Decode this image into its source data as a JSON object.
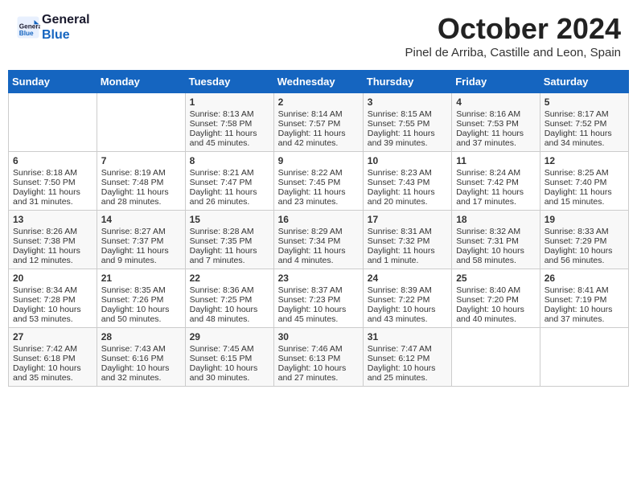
{
  "header": {
    "logo_line1": "General",
    "logo_line2": "Blue",
    "month_title": "October 2024",
    "location": "Pinel de Arriba, Castille and Leon, Spain"
  },
  "days_of_week": [
    "Sunday",
    "Monday",
    "Tuesday",
    "Wednesday",
    "Thursday",
    "Friday",
    "Saturday"
  ],
  "weeks": [
    [
      {
        "day": "",
        "content": ""
      },
      {
        "day": "",
        "content": ""
      },
      {
        "day": "1",
        "content": "Sunrise: 8:13 AM\nSunset: 7:58 PM\nDaylight: 11 hours and 45 minutes."
      },
      {
        "day": "2",
        "content": "Sunrise: 8:14 AM\nSunset: 7:57 PM\nDaylight: 11 hours and 42 minutes."
      },
      {
        "day": "3",
        "content": "Sunrise: 8:15 AM\nSunset: 7:55 PM\nDaylight: 11 hours and 39 minutes."
      },
      {
        "day": "4",
        "content": "Sunrise: 8:16 AM\nSunset: 7:53 PM\nDaylight: 11 hours and 37 minutes."
      },
      {
        "day": "5",
        "content": "Sunrise: 8:17 AM\nSunset: 7:52 PM\nDaylight: 11 hours and 34 minutes."
      }
    ],
    [
      {
        "day": "6",
        "content": "Sunrise: 8:18 AM\nSunset: 7:50 PM\nDaylight: 11 hours and 31 minutes."
      },
      {
        "day": "7",
        "content": "Sunrise: 8:19 AM\nSunset: 7:48 PM\nDaylight: 11 hours and 28 minutes."
      },
      {
        "day": "8",
        "content": "Sunrise: 8:21 AM\nSunset: 7:47 PM\nDaylight: 11 hours and 26 minutes."
      },
      {
        "day": "9",
        "content": "Sunrise: 8:22 AM\nSunset: 7:45 PM\nDaylight: 11 hours and 23 minutes."
      },
      {
        "day": "10",
        "content": "Sunrise: 8:23 AM\nSunset: 7:43 PM\nDaylight: 11 hours and 20 minutes."
      },
      {
        "day": "11",
        "content": "Sunrise: 8:24 AM\nSunset: 7:42 PM\nDaylight: 11 hours and 17 minutes."
      },
      {
        "day": "12",
        "content": "Sunrise: 8:25 AM\nSunset: 7:40 PM\nDaylight: 11 hours and 15 minutes."
      }
    ],
    [
      {
        "day": "13",
        "content": "Sunrise: 8:26 AM\nSunset: 7:38 PM\nDaylight: 11 hours and 12 minutes."
      },
      {
        "day": "14",
        "content": "Sunrise: 8:27 AM\nSunset: 7:37 PM\nDaylight: 11 hours and 9 minutes."
      },
      {
        "day": "15",
        "content": "Sunrise: 8:28 AM\nSunset: 7:35 PM\nDaylight: 11 hours and 7 minutes."
      },
      {
        "day": "16",
        "content": "Sunrise: 8:29 AM\nSunset: 7:34 PM\nDaylight: 11 hours and 4 minutes."
      },
      {
        "day": "17",
        "content": "Sunrise: 8:31 AM\nSunset: 7:32 PM\nDaylight: 11 hours and 1 minute."
      },
      {
        "day": "18",
        "content": "Sunrise: 8:32 AM\nSunset: 7:31 PM\nDaylight: 10 hours and 58 minutes."
      },
      {
        "day": "19",
        "content": "Sunrise: 8:33 AM\nSunset: 7:29 PM\nDaylight: 10 hours and 56 minutes."
      }
    ],
    [
      {
        "day": "20",
        "content": "Sunrise: 8:34 AM\nSunset: 7:28 PM\nDaylight: 10 hours and 53 minutes."
      },
      {
        "day": "21",
        "content": "Sunrise: 8:35 AM\nSunset: 7:26 PM\nDaylight: 10 hours and 50 minutes."
      },
      {
        "day": "22",
        "content": "Sunrise: 8:36 AM\nSunset: 7:25 PM\nDaylight: 10 hours and 48 minutes."
      },
      {
        "day": "23",
        "content": "Sunrise: 8:37 AM\nSunset: 7:23 PM\nDaylight: 10 hours and 45 minutes."
      },
      {
        "day": "24",
        "content": "Sunrise: 8:39 AM\nSunset: 7:22 PM\nDaylight: 10 hours and 43 minutes."
      },
      {
        "day": "25",
        "content": "Sunrise: 8:40 AM\nSunset: 7:20 PM\nDaylight: 10 hours and 40 minutes."
      },
      {
        "day": "26",
        "content": "Sunrise: 8:41 AM\nSunset: 7:19 PM\nDaylight: 10 hours and 37 minutes."
      }
    ],
    [
      {
        "day": "27",
        "content": "Sunrise: 7:42 AM\nSunset: 6:18 PM\nDaylight: 10 hours and 35 minutes."
      },
      {
        "day": "28",
        "content": "Sunrise: 7:43 AM\nSunset: 6:16 PM\nDaylight: 10 hours and 32 minutes."
      },
      {
        "day": "29",
        "content": "Sunrise: 7:45 AM\nSunset: 6:15 PM\nDaylight: 10 hours and 30 minutes."
      },
      {
        "day": "30",
        "content": "Sunrise: 7:46 AM\nSunset: 6:13 PM\nDaylight: 10 hours and 27 minutes."
      },
      {
        "day": "31",
        "content": "Sunrise: 7:47 AM\nSunset: 6:12 PM\nDaylight: 10 hours and 25 minutes."
      },
      {
        "day": "",
        "content": ""
      },
      {
        "day": "",
        "content": ""
      }
    ]
  ]
}
